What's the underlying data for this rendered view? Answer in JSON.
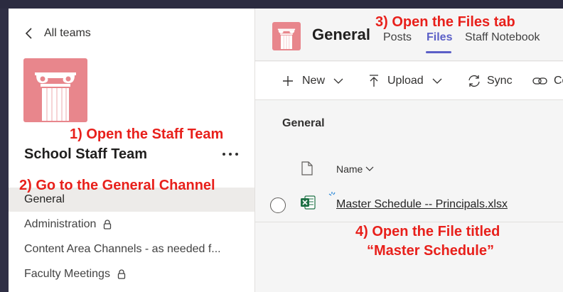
{
  "sidebar": {
    "back_label": "All teams",
    "team_name": "School Staff Team",
    "channels": [
      {
        "label": "General",
        "active": true,
        "private": false
      },
      {
        "label": "Administration",
        "active": false,
        "private": true
      },
      {
        "label": "Content Area Channels - as needed f...",
        "active": false,
        "private": false
      },
      {
        "label": "Faculty Meetings",
        "active": false,
        "private": true
      }
    ]
  },
  "main": {
    "title": "General",
    "tabs": [
      {
        "label": "Posts",
        "active": false
      },
      {
        "label": "Files",
        "active": true
      },
      {
        "label": "Staff Notebook",
        "active": false
      }
    ],
    "toolbar": {
      "new_label": "New",
      "upload_label": "Upload",
      "sync_label": "Sync",
      "copy_label_partial": "Co"
    },
    "breadcrumb": "General",
    "column_name": "Name",
    "files": [
      {
        "name": "Master Schedule -- Principals.xlsx",
        "type": "excel"
      }
    ]
  },
  "annotations": {
    "step1": "1) Open the Staff Team",
    "step2": "2) Go to the General Channel",
    "step3": "3) Open the Files tab",
    "step4_line1": "4) Open the File titled",
    "step4_line2": "“Master Schedule”"
  },
  "colors": {
    "accent": "#5b5fc7",
    "team_logo": "#e8868c",
    "annotation": "#e8201b",
    "excel": "#1d7044"
  }
}
